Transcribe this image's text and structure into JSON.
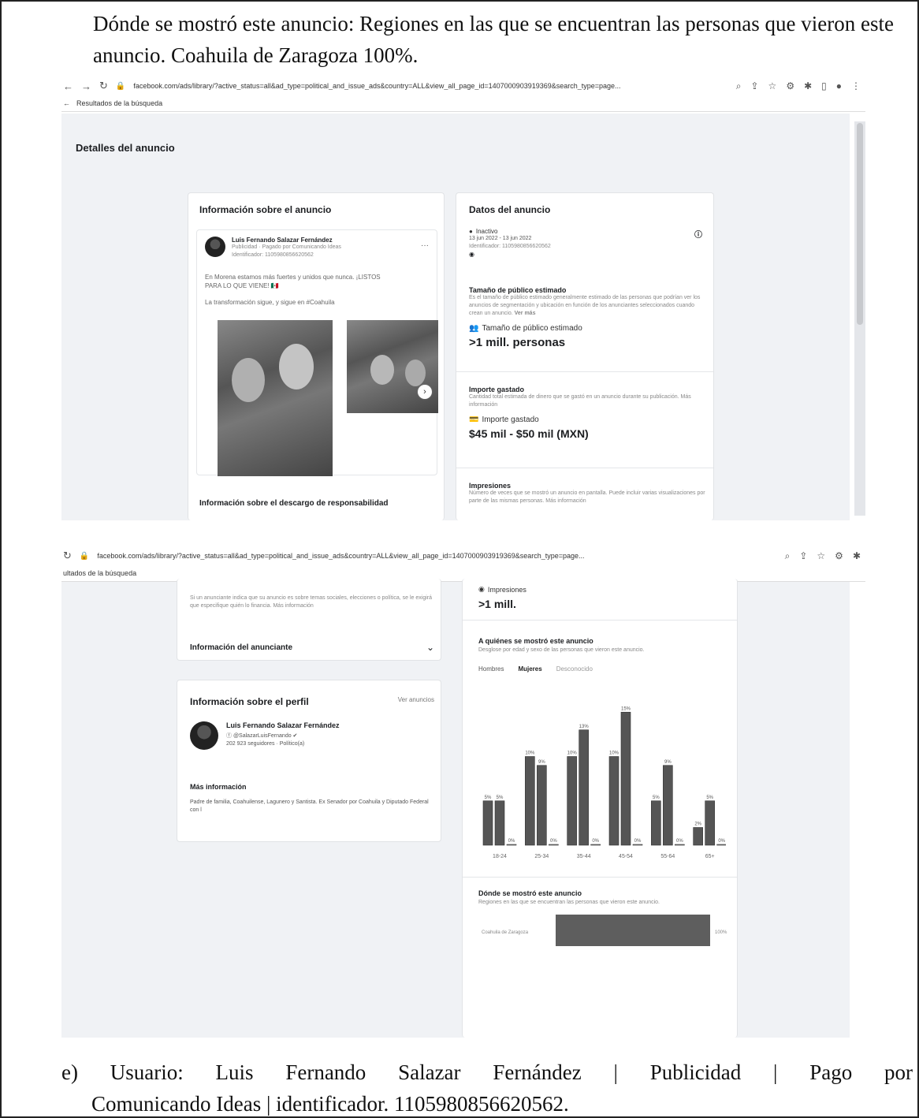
{
  "document": {
    "intro_text": "Dónde se mostró este anuncio: Regiones en las que se encuentran las personas que vieron este anuncio. Coahuila de Zaragoza 100%.",
    "footer_line1": "e)  Usuario:  Luis  Fernando  Salazar  Fernández  |  Publicidad  |  Pago  por",
    "footer_line2": "Comunicando Ideas | identificador. 1105980856620562."
  },
  "browser1": {
    "url": "facebook.com/ads/library/?active_status=all&ad_type=political_and_issue_ads&country=ALL&view_all_page_id=1407000903919369&search_type=page...",
    "back_label": "Resultados de la búsqueda"
  },
  "browser2": {
    "url": "facebook.com/ads/library/?active_status=all&ad_type=political_and_issue_ads&country=ALL&view_all_page_id=1407000903919369&search_type=page...",
    "back_label": "ultados de la búsqueda"
  },
  "ad_details": {
    "title": "Detalles del anuncio",
    "info_card": {
      "title": "Información sobre el anuncio",
      "advertiser": "Luis Fernando Salazar Fernández",
      "sponsor": "Publicidad · Pagado por Comunicando Ideas",
      "identifier": "Identificador: 1105980856620562",
      "post_text": "En Morena estamos más fuertes y unidos que nunca. ¡LISTOS PARA LO QUE VIENE! 🇲🇽",
      "post_text2": "La transformación sigue, y sigue en #Coahuila",
      "disclaimer": "Información sobre el descargo de responsabilidad"
    },
    "data_card": {
      "title": "Datos del anuncio",
      "status": "Inactivo",
      "dates": "13 jun 2022 - 13 jun 2022",
      "identifier": "Identificador: 1105980856620562",
      "audience_title": "Tamaño de público estimado",
      "audience_desc": "Es el tamaño de público estimado generalmente estimado de las personas que podrían ver los anuncios de segmentación y ubicación en función de los anunciantes seleccionados cuando crean un anuncio.",
      "see_more": "Ver más",
      "audience_label": "Tamaño de público estimado",
      "audience_value": ">1 mill. personas",
      "spend_title": "Importe gastado",
      "spend_desc": "Cantidad total estimada de dinero que se gastó en un anuncio durante su publicación. Más información",
      "spend_label": "Importe gastado",
      "spend_value": "$45 mil - $50 mil (MXN)",
      "impressions_title": "Impresiones",
      "impressions_desc": "Número de veces que se mostró un anuncio en pantalla. Puede incluir varias visualizaciones por parte de las mismas personas. Más información"
    }
  },
  "ad_details2": {
    "disclaimer_desc": "Si un anunciante indica que su anuncio es sobre temas sociales, elecciones o política, se le exigirá que especifique quién lo financia. Más información",
    "advertiser_info": "Información del anunciante",
    "profile": {
      "title": "Información sobre el perfil",
      "see_ads": "Ver anuncios",
      "name": "Luis Fernando Salazar Fernández",
      "handle": "@SalazarLuisFernando",
      "followers": "202 923 seguidores · Político(a)",
      "more_title": "Más información",
      "more_text": "Padre de familia, Coahuilense, Lagunero y Santista. Ex Senador por Coahuila y Diputado Federal con l"
    },
    "impressions_label": "Impresiones",
    "impressions_value": ">1 mill.",
    "who_title": "A quiénes se mostró este anuncio",
    "who_desc": "Desglose por edad y sexo de las personas que vieron este anuncio.",
    "tabs": [
      "Hombres",
      "Mujeres",
      "Desconocido"
    ],
    "where_title": "Dónde se mostró este anuncio",
    "where_desc": "Regiones en las que se encuentran las personas que vieron este anuncio.",
    "region_name": "Coahuila de Zaragoza",
    "region_pct": "100%"
  },
  "chart_data": {
    "type": "bar",
    "categories": [
      "18-24",
      "25-34",
      "35-44",
      "45-54",
      "55-64",
      "65+"
    ],
    "series": [
      {
        "name": "Hombres",
        "values": [
          5,
          10,
          10,
          10,
          5,
          2
        ]
      },
      {
        "name": "Mujeres",
        "values": [
          5,
          9,
          13,
          15,
          9,
          5
        ]
      },
      {
        "name": "Desconocido",
        "values": [
          0,
          0,
          0,
          0,
          0,
          0
        ]
      }
    ],
    "labels": [
      [
        "5%",
        "5%",
        "0%"
      ],
      [
        "10%",
        "9%",
        "0%"
      ],
      [
        "10%",
        "13%",
        "0%"
      ],
      [
        "10%",
        "15%",
        "0%"
      ],
      [
        "5%",
        "9%",
        "0%"
      ],
      [
        "2%",
        "5%",
        "0%"
      ]
    ],
    "ylim": [
      0,
      16
    ],
    "colors": {
      "bar": "#555555"
    }
  }
}
